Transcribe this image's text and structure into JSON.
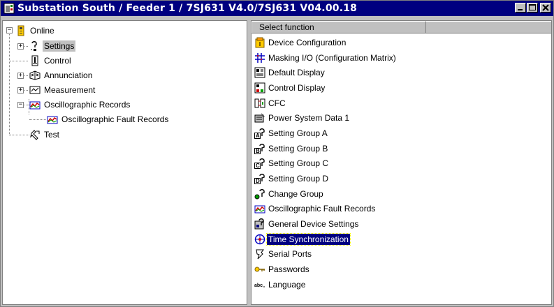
{
  "window": {
    "title": "Substation South / Feeder 1 / 7SJ631 V4.0/7SJ631 V04.00.18",
    "buttons": [
      "minimize",
      "maximize",
      "close"
    ]
  },
  "tree": {
    "root": {
      "label": "Online",
      "icon": "device-icon",
      "expanded": true
    },
    "items": [
      {
        "label": "Settings",
        "icon": "settings-icon",
        "expander": "+",
        "selected": true
      },
      {
        "label": "Control",
        "icon": "control-icon",
        "expander": ""
      },
      {
        "label": "Annunciation",
        "icon": "annunciation-icon",
        "expander": "+"
      },
      {
        "label": "Measurement",
        "icon": "measurement-icon",
        "expander": "+"
      },
      {
        "label": "Oscillographic Records",
        "icon": "oscillograph-icon",
        "expander": "-"
      },
      {
        "label": "Oscillographic Fault Records",
        "icon": "oscillograph-icon",
        "expander": "",
        "child": true
      },
      {
        "label": "Test",
        "icon": "test-icon",
        "expander": ""
      }
    ]
  },
  "list": {
    "header": "Select function",
    "items": [
      {
        "label": "Device Configuration",
        "icon": "device-config-icon"
      },
      {
        "label": "Masking I/O (Configuration Matrix)",
        "icon": "matrix-icon"
      },
      {
        "label": "Default Display",
        "icon": "default-display-icon"
      },
      {
        "label": "Control Display",
        "icon": "control-display-icon"
      },
      {
        "label": "CFC",
        "icon": "cfc-icon"
      },
      {
        "label": "Power System Data 1",
        "icon": "power-system-icon"
      },
      {
        "label": "Setting Group A",
        "icon": "setting-group-a-icon"
      },
      {
        "label": "Setting Group B",
        "icon": "setting-group-b-icon"
      },
      {
        "label": "Setting Group C",
        "icon": "setting-group-c-icon"
      },
      {
        "label": "Setting Group D",
        "icon": "setting-group-d-icon"
      },
      {
        "label": "Change Group",
        "icon": "change-group-icon"
      },
      {
        "label": "Oscillographic Fault Records",
        "icon": "oscillograph-icon"
      },
      {
        "label": "General Device Settings",
        "icon": "general-settings-icon"
      },
      {
        "label": "Time Synchronization",
        "icon": "time-sync-icon",
        "selected": true
      },
      {
        "label": "Serial Ports",
        "icon": "serial-ports-icon"
      },
      {
        "label": "Passwords",
        "icon": "passwords-icon"
      },
      {
        "label": "Language",
        "icon": "language-icon"
      }
    ]
  },
  "colors": {
    "titlebar": "#000080",
    "selection": "#000080",
    "face": "#c0c0c0"
  }
}
